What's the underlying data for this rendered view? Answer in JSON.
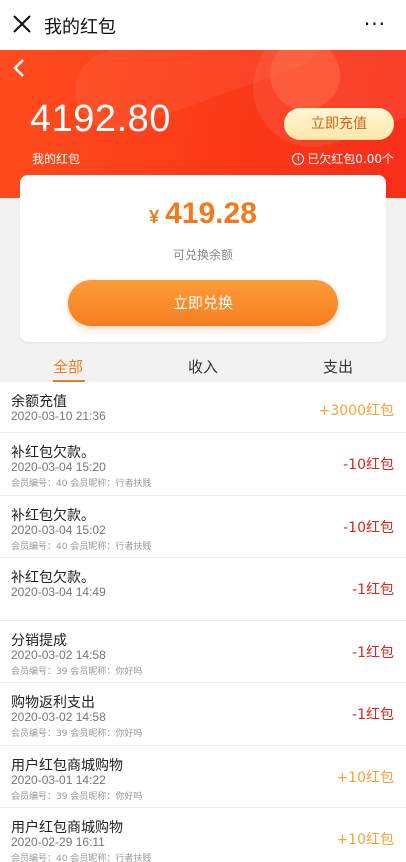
{
  "topbar": {
    "title": "我的红包",
    "more": "···"
  },
  "header": {
    "balance": "4192.80",
    "balance_label": "我的红包",
    "recharge_label": "立即充值",
    "debt_text": "已欠红包0.00个",
    "gradient_start": "#ff4d1e",
    "gradient_end": "#f72e1a"
  },
  "card": {
    "currency_symbol": "¥",
    "amount": "419.28",
    "amount_label": "可兑换余额",
    "exchange_label": "立即兑换",
    "accent": "#f27a1c"
  },
  "tabs": [
    {
      "label": "全部",
      "active": true
    },
    {
      "label": "收入",
      "active": false
    },
    {
      "label": "支出",
      "active": false
    }
  ],
  "transactions": [
    {
      "name": "余额充值",
      "time": "2020-03-10 21:36",
      "meta": "",
      "value": "+3000红包",
      "type": "pos"
    },
    {
      "name": "补红包欠款。",
      "time": "2020-03-04 15:20",
      "meta": "会员编号：40 会员昵称：行者扶贱",
      "value": "-10红包",
      "type": "neg"
    },
    {
      "name": "补红包欠款。",
      "time": "2020-03-04 15:02",
      "meta": "会员编号：40 会员昵称：行者扶贱",
      "value": "-10红包",
      "type": "neg"
    },
    {
      "name": "补红包欠款。",
      "time": "2020-03-04 14:49",
      "meta": "",
      "value": "-1红包",
      "type": "neg"
    },
    {
      "name": "分销提成",
      "time": "2020-03-02 14:58",
      "meta": "会员编号：39 会员昵称：你好吗",
      "value": "-1红包",
      "type": "neg"
    },
    {
      "name": "购物返利支出",
      "time": "2020-03-02 14:58",
      "meta": "会员编号：39 会员昵称：你好吗",
      "value": "-1红包",
      "type": "neg"
    },
    {
      "name": "用户红包商城购物",
      "time": "2020-03-01 14:22",
      "meta": "会员编号：39 会员昵称：你好吗",
      "value": "+10红包",
      "type": "pos"
    },
    {
      "name": "用户红包商城购物",
      "time": "2020-02-29 16:11",
      "meta": "会员编号：40 会员昵称：行者扶贱",
      "value": "+10红包",
      "type": "pos"
    }
  ]
}
